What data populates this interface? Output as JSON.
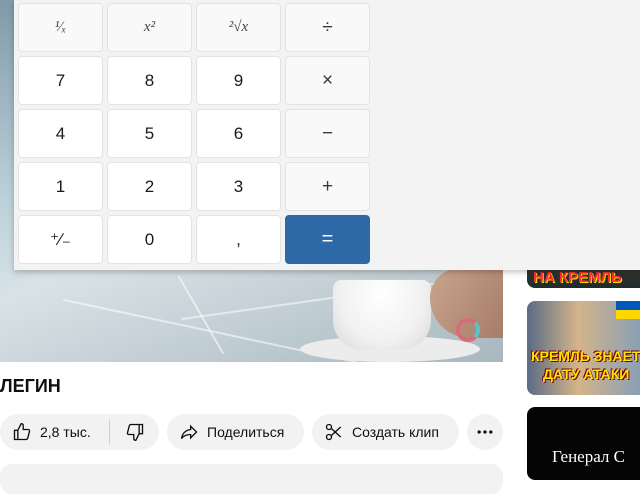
{
  "video": {
    "title": "ЛЕГИН",
    "like_count": "2,8 тыс.",
    "share_label": "Поделиться",
    "clip_label": "Создать клип"
  },
  "sidebar": {
    "thumbnails": [
      {
        "caption": "НА КРЕМЛЬ"
      },
      {
        "caption_line1": "КРЕМЛЬ ЗНАЕТ",
        "caption_line2": "ДАТУ АТАКИ"
      },
      {
        "caption": "Генерал С"
      }
    ]
  },
  "calculator": {
    "keys": [
      {
        "label": "¹⁄ₓ",
        "type": "fnkey"
      },
      {
        "label": "x²",
        "type": "fnkey"
      },
      {
        "label": "²√x",
        "type": "fnkey"
      },
      {
        "label": "÷",
        "type": "op"
      },
      {
        "label": "7",
        "type": "num"
      },
      {
        "label": "8",
        "type": "num"
      },
      {
        "label": "9",
        "type": "num"
      },
      {
        "label": "×",
        "type": "op"
      },
      {
        "label": "4",
        "type": "num"
      },
      {
        "label": "5",
        "type": "num"
      },
      {
        "label": "6",
        "type": "num"
      },
      {
        "label": "−",
        "type": "op"
      },
      {
        "label": "1",
        "type": "num"
      },
      {
        "label": "2",
        "type": "num"
      },
      {
        "label": "3",
        "type": "num"
      },
      {
        "label": "+",
        "type": "op"
      },
      {
        "label": "⁺∕₋",
        "type": "num"
      },
      {
        "label": "0",
        "type": "num"
      },
      {
        "label": ",",
        "type": "num"
      },
      {
        "label": "=",
        "type": "eq"
      }
    ],
    "equals_color": "#2d69a6"
  }
}
